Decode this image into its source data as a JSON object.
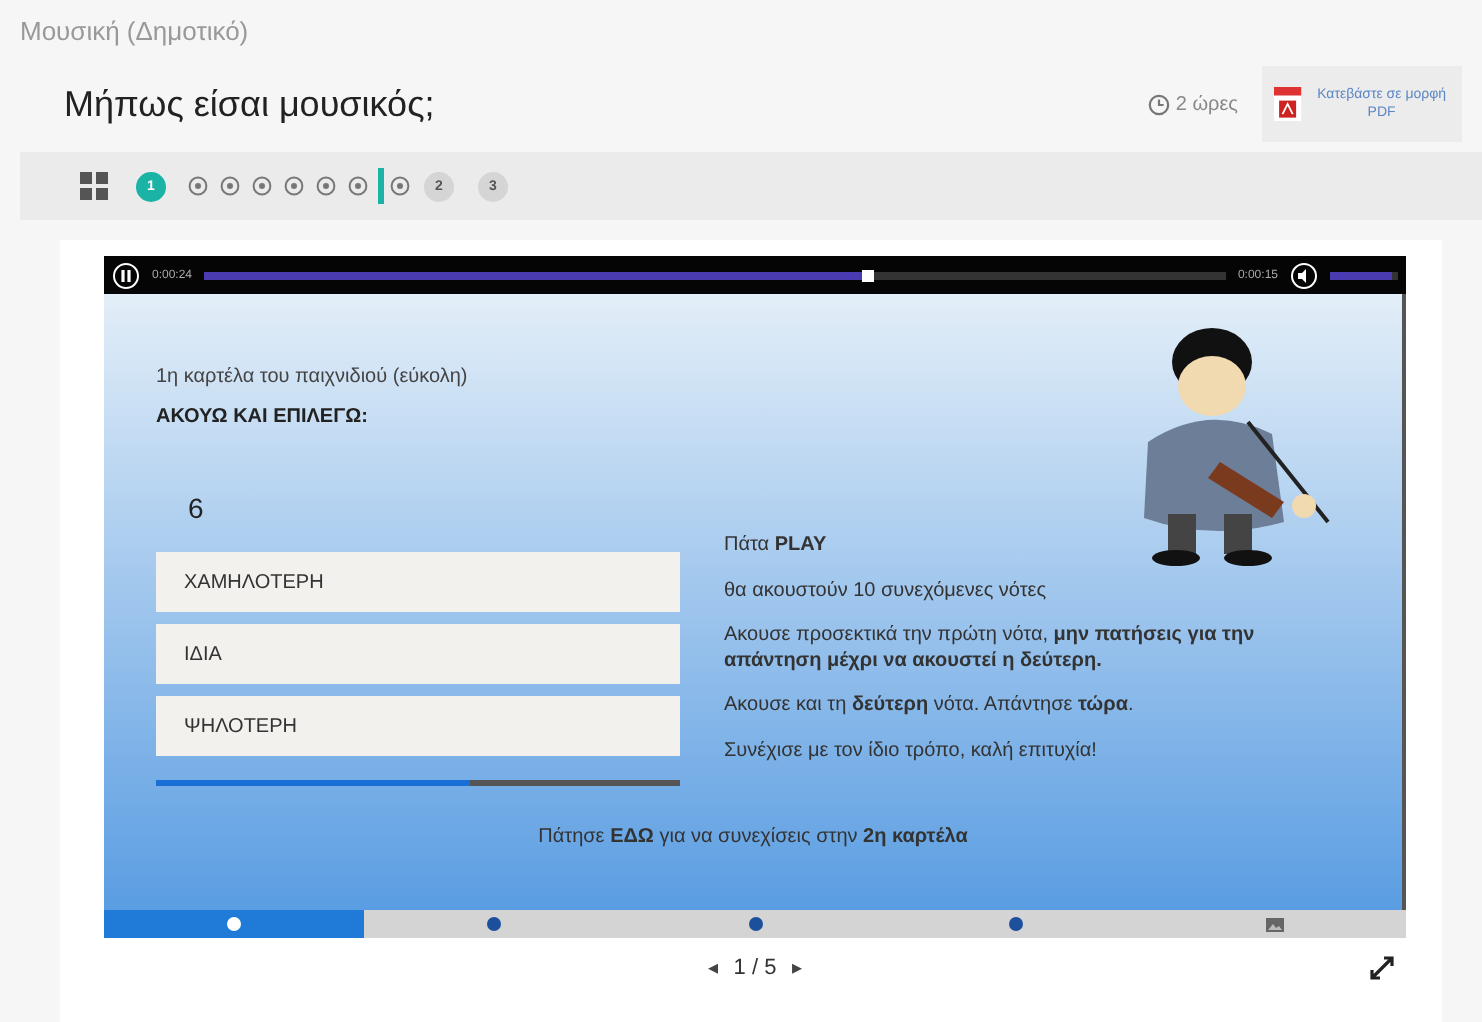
{
  "breadcrumb": "Μουσική (Δημοτικό)",
  "title": "Μήπως είσαι μουσικός;",
  "duration": "2 ώρες",
  "pdf_button": "Κατεβάστε σε μορφή PDF",
  "steps": [
    {
      "label": "1",
      "selected": true,
      "substeps": [
        {
          "selected": false
        },
        {
          "selected": false
        },
        {
          "selected": false
        },
        {
          "selected": false
        },
        {
          "selected": false
        },
        {
          "selected": false
        },
        {
          "selected": true
        }
      ]
    },
    {
      "label": "2",
      "selected": false
    },
    {
      "label": "3",
      "selected": false
    }
  ],
  "player": {
    "elapsed": "0:00:24",
    "remaining": "0:00:15",
    "level": 0.65,
    "volume": {
      "level": 0.9
    }
  },
  "slide": {
    "subtitle": "1η καρτέλα του παιχνιδιού (εύκολη)",
    "heading": "ΑΚΟΥΩ ΚΑΙ ΕΠΙΛΕΓΩ:",
    "counter": "6",
    "options": [
      "ΧΑΜΗΛΟΤΕΡΗ",
      "ΙΔΙΑ",
      "ΨΗΛΟΤΕΡΗ"
    ],
    "progress": {
      "level": 0.6
    },
    "instructions": [
      "Πάτα  **PLAY**",
      "θα ακουστούν 10 συνεχόμενες νότες",
      "Ακουσε προσεκτικά την πρώτη νότα, **μην πατήσεις για την απάντηση μέχρι να ακουστεί η δεύτερη.**",
      "Ακουσε  και τη **δεύτερη** νότα. Απάντησε **τώρα**.",
      "Συνέχισε με τον ίδιο τρόπο, καλή επιτυχία!"
    ],
    "footer": "Πάτησε **ΕΔΩ** για να συνεχίσεις στην **2η καρτέλα**"
  },
  "slide_tabs": [
    {
      "kind": "circle",
      "selected": true
    },
    {
      "kind": "dot",
      "selected": false
    },
    {
      "kind": "dot",
      "selected": false
    },
    {
      "kind": "dot",
      "selected": false
    },
    {
      "kind": "image",
      "selected": false
    }
  ],
  "pagination": {
    "prev": "◂",
    "current": "1 / 5",
    "next": "▸"
  }
}
